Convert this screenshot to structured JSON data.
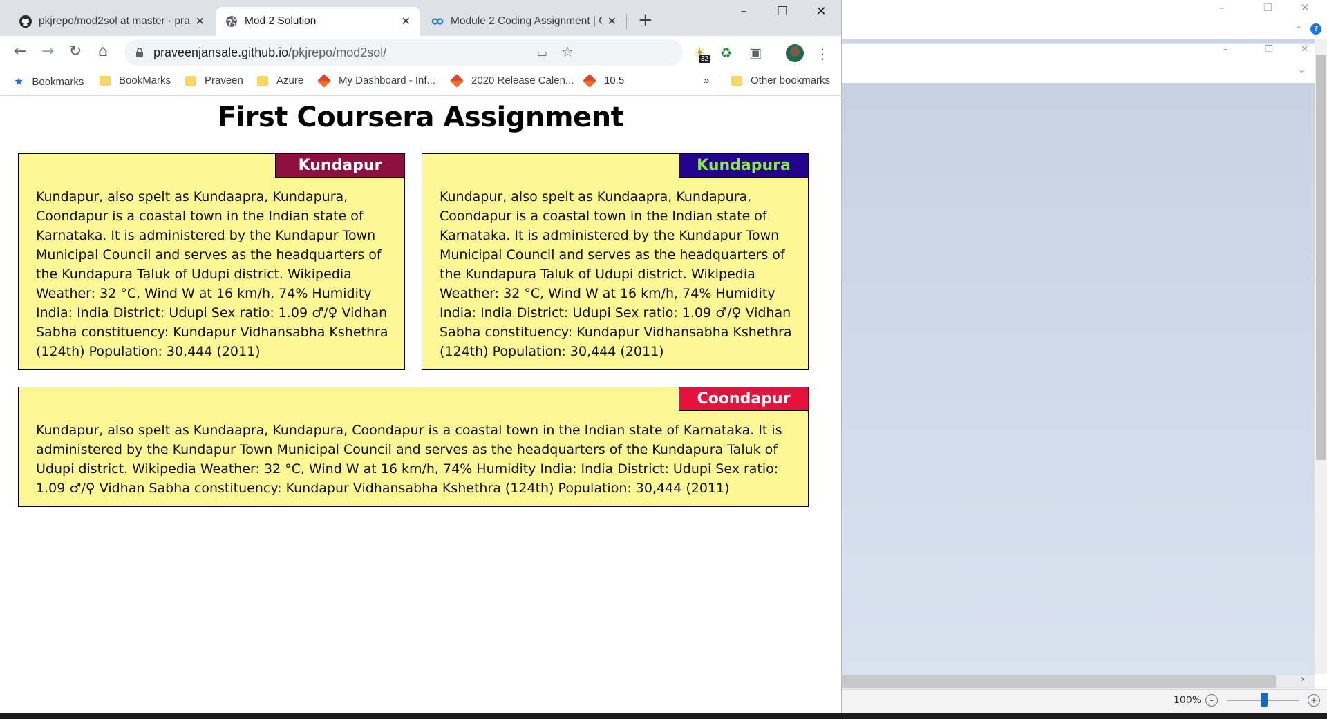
{
  "browser": {
    "tabs": [
      {
        "title": "pkjrepo/mod2sol at master · pra",
        "icon": "github-icon"
      },
      {
        "title": "Mod 2 Solution",
        "icon": "globe-icon"
      },
      {
        "title": "Module 2 Coding Assignment | C",
        "icon": "coursera-icon"
      }
    ],
    "new_tab_symbol": "+",
    "window_controls": {
      "minimize": "–",
      "maximize": "☐",
      "close": "✕"
    },
    "url_host": "praveenjansale.github.io",
    "url_path": "/pkjrepo/mod2sol/",
    "extension_badge": "32",
    "bookmarks": [
      "Bookmarks",
      "BookMarks",
      "Praveen",
      "Azure",
      "My Dashboard - Inf...",
      "2020 Release Calen...",
      "10.5"
    ],
    "bookmarks_overflow": "»",
    "other_bookmarks": "Other bookmarks"
  },
  "page": {
    "heading": "First Coursera Assignment",
    "sections": [
      {
        "label": "Kundapur",
        "label_bg": "#8c1040",
        "label_color": "#ffffff",
        "text": "Kundapur, also spelt as Kundaapra, Kundapura, Coondapur is a coastal town in the Indian state of Karnataka. It is administered by the Kundapur Town Municipal Council and serves as the headquarters of the Kundapura Taluk of Udupi district. Wikipedia Weather: 32 °C, Wind W at 16 km/h, 74% Humidity India: India District: Udupi Sex ratio: 1.09 ♂/♀ Vidhan Sabha constituency: Kundapur Vidhansabha Kshethra (124th) Population: 30,444 (2011)"
      },
      {
        "label": "Kundapura",
        "label_bg": "#24048c",
        "label_color": "#8de842",
        "text": "Kundapur, also spelt as Kundaapra, Kundapura, Coondapur is a coastal town in the Indian state of Karnataka. It is administered by the Kundapur Town Municipal Council and serves as the headquarters of the Kundapura Taluk of Udupi district. Wikipedia Weather: 32 °C, Wind W at 16 km/h, 74% Humidity India: India District: Udupi Sex ratio: 1.09 ♂/♀ Vidhan Sabha constituency: Kundapur Vidhansabha Kshethra (124th) Population: 30,444 (2011)"
      },
      {
        "label": "Coondapur",
        "label_bg": "#e8103c",
        "label_color": "#ffffff",
        "text": "Kundapur, also spelt as Kundaapra, Kundapura, Coondapur is a coastal town in the Indian state of Karnataka. It is administered by the Kundapur Town Municipal Council and serves as the headquarters of the Kundapura Taluk of Udupi district. Wikipedia Weather: 32 °C, Wind W at 16 km/h, 74% Humidity India: India District: Udupi Sex ratio: 1.09 ♂/♀ Vidhan Sabha constituency: Kundapur Vidhansabha Kshethra (124th) Population: 30,444 (2011)"
      }
    ]
  },
  "background_app": {
    "zoom": "100%",
    "help": "?"
  }
}
